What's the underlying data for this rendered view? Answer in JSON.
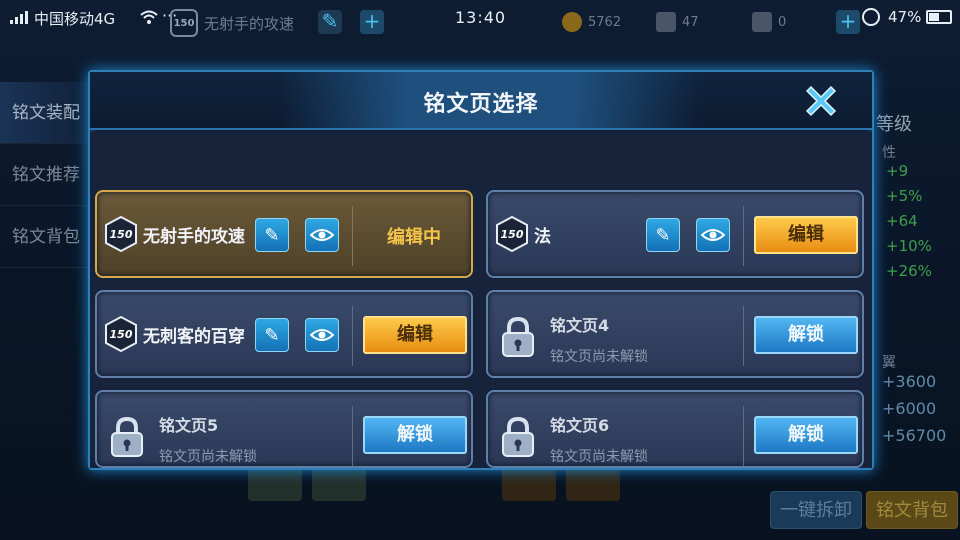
{
  "status_bar": {
    "carrier": "中国移动4G",
    "dots": "···",
    "time": "13:40",
    "battery": "47%"
  },
  "background": {
    "page_name": "无射手的攻速",
    "gold": "5762",
    "gems": "47",
    "shards": "0",
    "left_nav": [
      "铭文装配",
      "铭文推荐",
      "铭文背包"
    ],
    "right_header": "等级",
    "right_sub": "性",
    "right_stats_1": [
      "+9",
      "+5%",
      "+64",
      "+10%",
      "+26%"
    ],
    "right_sub2": "翼",
    "right_stats_2": [
      "+3600",
      "+6000",
      "+56700"
    ],
    "btn_unload": "一键拆卸",
    "btn_bag": "铭文背包"
  },
  "modal": {
    "title": "铭文页选择",
    "pages": [
      {
        "level": "150",
        "name": "无射手的攻速",
        "state": "编辑中"
      },
      {
        "level": "150",
        "name": "法",
        "action": "编辑"
      },
      {
        "level": "150",
        "name": "无刺客的百穿",
        "action": "编辑"
      },
      {
        "name": "铭文页4",
        "sub": "铭文页尚未解锁",
        "action": "解锁"
      },
      {
        "name": "铭文页5",
        "sub": "铭文页尚未解锁",
        "action": "解锁"
      },
      {
        "name": "铭文页6",
        "sub": "铭文页尚未解锁",
        "action": "解锁"
      }
    ]
  },
  "colors": {
    "accent_blue": "#2f7fb8",
    "edit_orange": "#f0a020",
    "editing_gold": "#f3c34b"
  }
}
